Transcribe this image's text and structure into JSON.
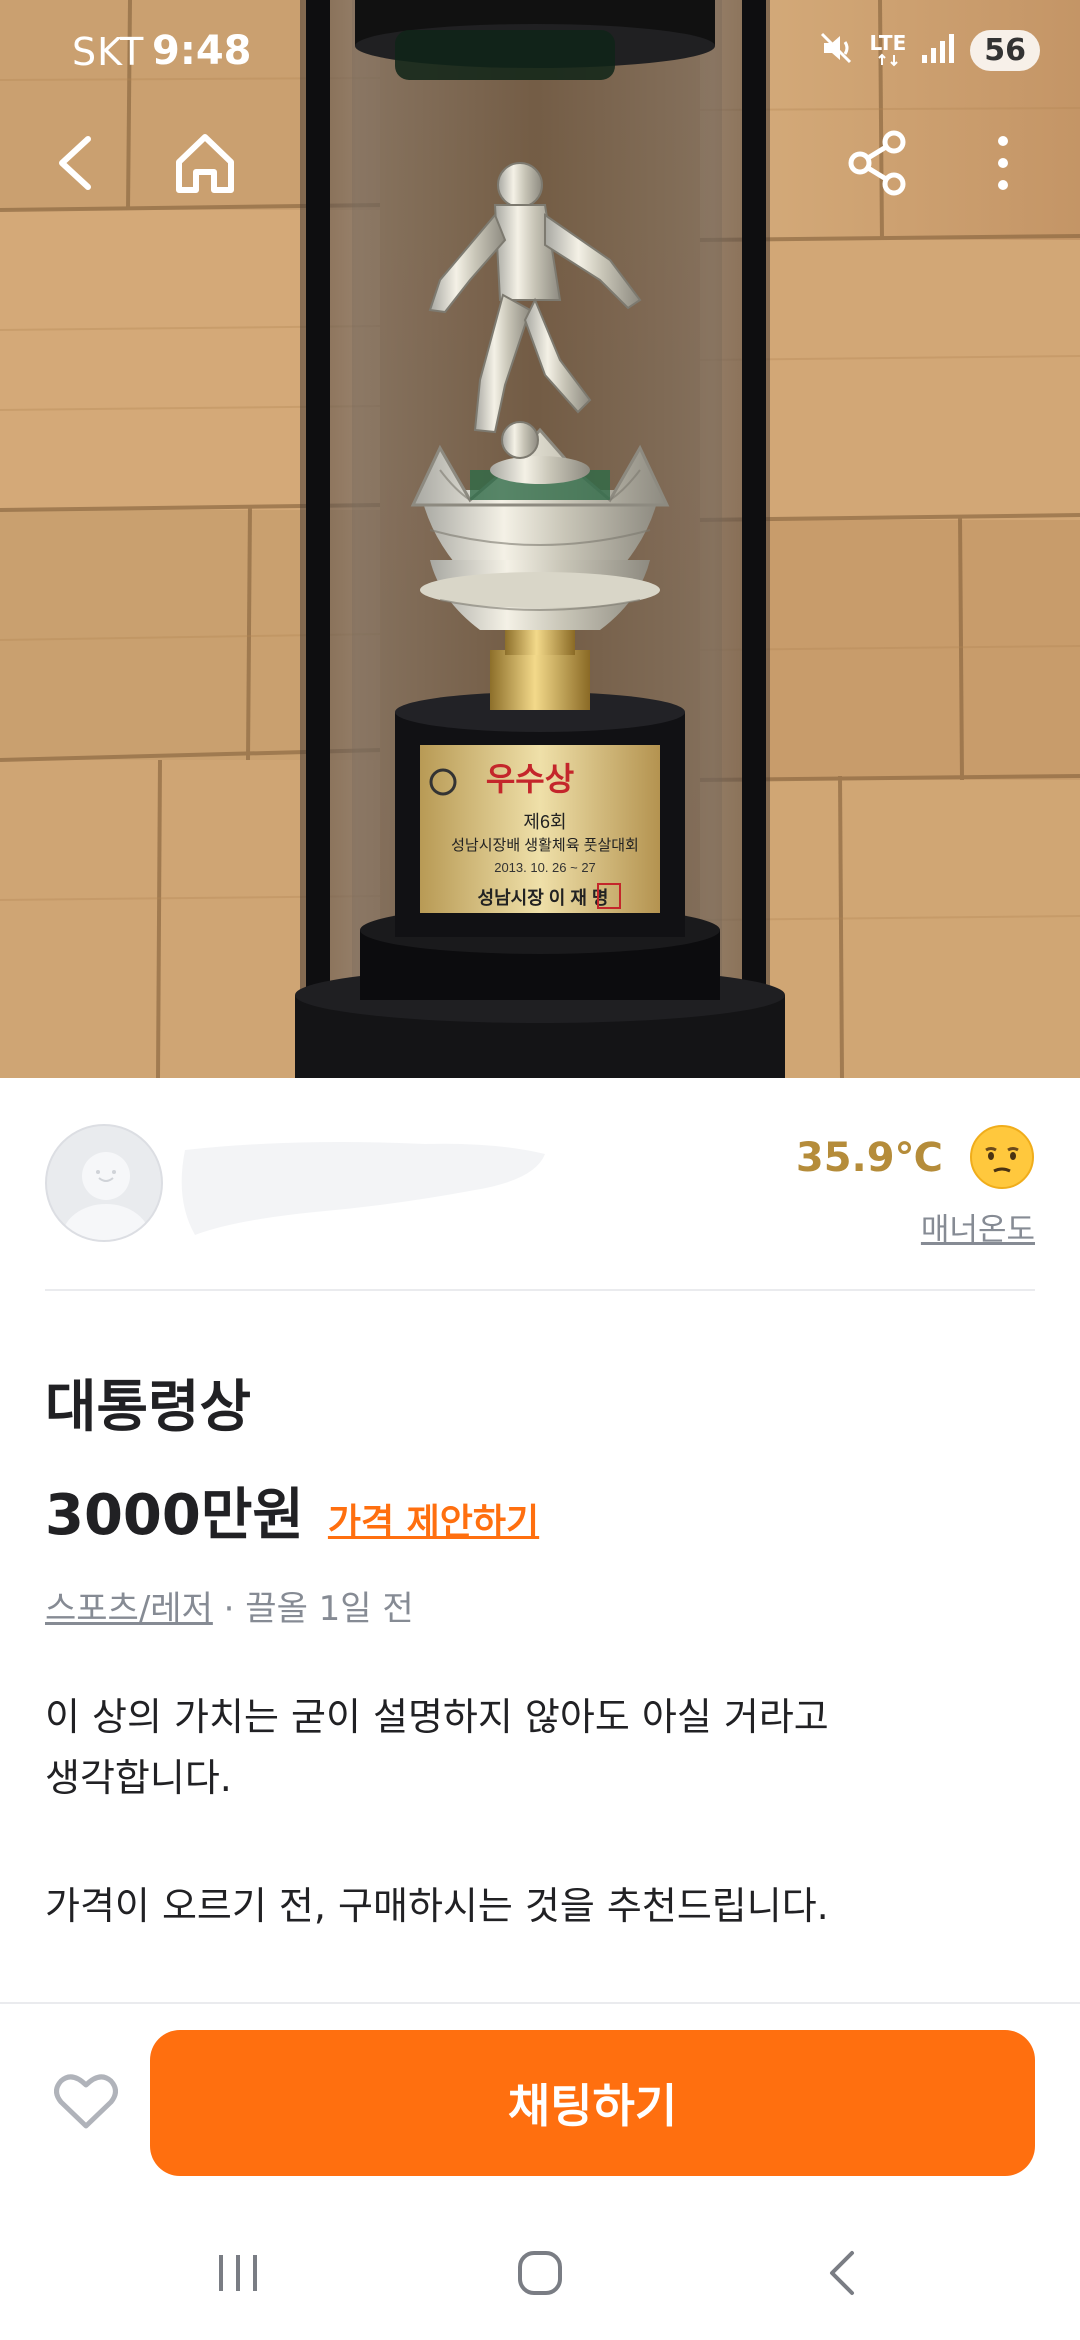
{
  "status_bar": {
    "carrier": "SKT",
    "time": "9:48",
    "network": "LTE",
    "battery": "56",
    "icons": [
      "mute-vibrate-icon",
      "lte-icon",
      "signal-icon",
      "battery-icon"
    ]
  },
  "top_nav": {
    "icons": [
      "back-arrow-icon",
      "home-icon",
      "share-icon",
      "more-vertical-icon"
    ]
  },
  "hero_image": {
    "subject": "trophy-photo",
    "plate_lines": [
      "우수상",
      "제6회",
      "성남시장배 생활체육 풋살대회",
      "2013. 10. 26 ~ 27",
      "성남시장 이 재 명"
    ]
  },
  "seller": {
    "manner_temperature": "35.9℃",
    "manner_label": "매너온도",
    "temperature_color": "#b58c3a"
  },
  "post": {
    "title": "대통령상",
    "price": "3000만원",
    "price_offer_label": "가격 제안하기",
    "category": "스포츠/레저",
    "meta_separator": " · ",
    "posted": "끌올 1일 전",
    "description": [
      "이 상의 가치는 굳이 설명하지 않아도 아실 거라고",
      "생각합니다.",
      "가격이 오르기 전, 구매하시는 것을 추천드립니다."
    ]
  },
  "actions": {
    "chat_label": "채팅하기",
    "accent_color": "#ff6f0f"
  },
  "system_nav": {
    "icons": [
      "recent-apps-icon",
      "home-circle-icon",
      "system-back-icon"
    ]
  }
}
